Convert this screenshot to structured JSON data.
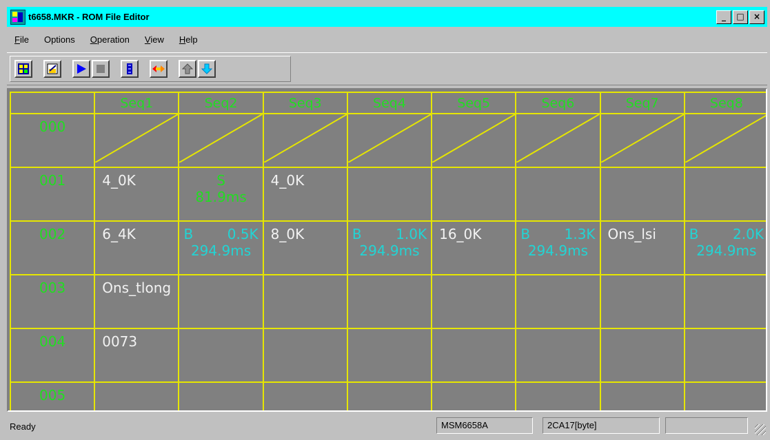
{
  "window": {
    "title": "t6658.MKR - ROM File Editor"
  },
  "window_buttons": [
    "_",
    "□",
    "×"
  ],
  "menu": [
    {
      "u": "F",
      "rest": "ile"
    },
    {
      "u": "",
      "rest": "Options"
    },
    {
      "u": "O",
      "rest": "peration"
    },
    {
      "u": "V",
      "rest": "iew"
    },
    {
      "u": "H",
      "rest": "elp"
    }
  ],
  "toolbar_icons": [
    "open-grid-icon",
    "edit-icon",
    "play-icon",
    "stop-icon",
    "insert-icon",
    "swap-icon",
    "move-up-icon",
    "move-down-icon"
  ],
  "grid": {
    "headers": [
      "Seq1",
      "Seq2",
      "Seq3",
      "Seq4",
      "Seq5",
      "Seq6",
      "Seq7",
      "Seq8"
    ],
    "rows": [
      {
        "label": "000",
        "cells": [
          "diag",
          "diag",
          "diag",
          "diag",
          "diag",
          "diag",
          "diag",
          "diag"
        ]
      },
      {
        "label": "001",
        "cells": [
          {
            "style": "white",
            "text": "4_0K"
          },
          {
            "style": "green",
            "line1": "S",
            "line2": "81.9ms"
          },
          {
            "style": "white",
            "text": "4_0K"
          },
          {
            "style": "empty"
          },
          {
            "style": "empty"
          },
          {
            "style": "empty"
          },
          {
            "style": "empty"
          },
          {
            "style": "empty"
          }
        ]
      },
      {
        "label": "002",
        "cells": [
          {
            "style": "white",
            "text": "6_4K"
          },
          {
            "style": "cyan",
            "prefix": "B",
            "value": "0.5K",
            "line2": "294.9ms"
          },
          {
            "style": "white",
            "text": "8_0K"
          },
          {
            "style": "cyan",
            "prefix": "B",
            "value": "1.0K",
            "line2": "294.9ms"
          },
          {
            "style": "white",
            "text": "16_0K"
          },
          {
            "style": "cyan",
            "prefix": "B",
            "value": "1.3K",
            "line2": "294.9ms"
          },
          {
            "style": "white",
            "text": "Ons_lsi"
          },
          {
            "style": "cyan",
            "prefix": "B",
            "value": "2.0K",
            "line2": "294.9ms"
          }
        ]
      },
      {
        "label": "003",
        "cells": [
          {
            "style": "white",
            "text": "Ons_tlong"
          },
          {
            "style": "empty"
          },
          {
            "style": "empty"
          },
          {
            "style": "empty"
          },
          {
            "style": "empty"
          },
          {
            "style": "empty"
          },
          {
            "style": "empty"
          },
          {
            "style": "empty"
          }
        ]
      },
      {
        "label": "004",
        "cells": [
          {
            "style": "white",
            "text": "0073"
          },
          {
            "style": "empty"
          },
          {
            "style": "empty"
          },
          {
            "style": "empty"
          },
          {
            "style": "empty"
          },
          {
            "style": "empty"
          },
          {
            "style": "empty"
          },
          {
            "style": "empty"
          }
        ]
      },
      {
        "label": "005",
        "cells": [
          {
            "style": "empty"
          },
          {
            "style": "empty"
          },
          {
            "style": "empty"
          },
          {
            "style": "empty"
          },
          {
            "style": "empty"
          },
          {
            "style": "empty"
          },
          {
            "style": "empty"
          },
          {
            "style": "empty"
          }
        ]
      }
    ]
  },
  "status": {
    "ready": "Ready",
    "device": "MSM6658A",
    "size": "2CA17[byte]",
    "extra": ""
  },
  "colors": {
    "grid_bg": "#808080",
    "grid_lines": "#e6e600",
    "green_text": "#22dd22",
    "cyan_text": "#22d4d4",
    "white_text": "#f2f2f2",
    "titlebar": "#00ffff"
  }
}
